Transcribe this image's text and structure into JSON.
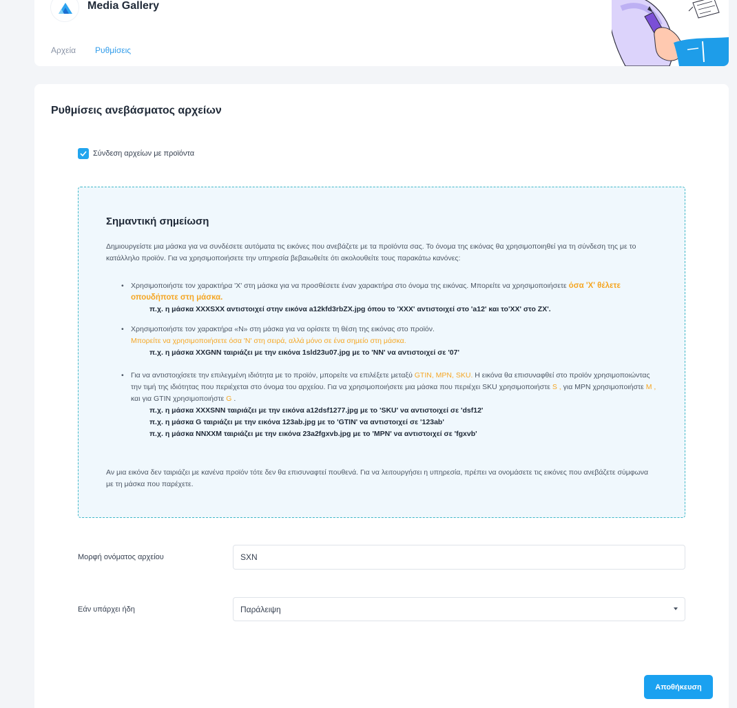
{
  "header": {
    "app_title": "Media Gallery",
    "tabs": [
      {
        "label": "Αρχεία",
        "active": false
      },
      {
        "label": "Ρυθμίσεις",
        "active": true
      }
    ]
  },
  "settings": {
    "section_title": "Ρυθμίσεις ανεβάσματος αρχείων",
    "link_files_checkbox": {
      "label": "Σύνδεση αρχείων με προϊόντα",
      "checked": true
    },
    "note": {
      "title": "Σημαντική σημείωση",
      "intro": "Δημιουργείστε μια μάσκα για να συνδέσετε αυτόματα τις εικόνες που ανεβάζετε με τα προϊόντα σας. Το όνομα της εικόνας θα χρησιμοποιηθεί για τη σύνδεση της με το κατάλληλο προϊόν. Για να χρησιμοποιήσετε την υπηρεσία βεβαιωθείτε ότι ακολουθείτε τους παρακάτω κανόνες:",
      "rules": [
        {
          "text": "Χρησιμοποιήστε τον χαρακτήρα 'X' στη μάσκα για να προσθέσετε έναν χαρακτήρα στο όνομα της εικόνας. Μπορείτε να χρησιμοποιήσετε ",
          "highlight": "όσα 'X' θέλετε οπουδήποτε στη μάσκα.",
          "examples": [
            "π.χ. η μάσκα XXXSXX αντιστοιχεί στην εικόνα a12kfd3rbZX.jpg όπου το 'XXX' αντιστοιχεί στο 'a12' και το'XX' στο ZX'."
          ]
        },
        {
          "text": "Χρησιμοποιήστε τον χαρακτήρα «N» στη μάσκα για να ορίσετε τη θέση της εικόνας στο προϊόν.",
          "highlight": "Μπορείτε να χρησιμοποιήσετε όσα 'N' στη σειρά, αλλά μόνο σε ένα σημείο στη μάσκα.",
          "examples": [
            "π.χ. η μάσκα XXGNN ταιριάζει με την εικόνα 1sld23u07.jpg με το 'NN' να αντιστοιχεί σε '07'"
          ]
        },
        {
          "text_1": "Για να αντιστοιχίσετε την επιλεγμένη ιδιότητα με το προϊόν, μπορείτε να επιλέξετε μεταξύ ",
          "highlight_1": "GTIN, MPN, SKU.",
          "text_2": " Η εικόνα θα επισυναφθεί στο προϊόν χρησιμοποιώντας την τιμή της ιδιότητας που περιέχεται στο όνομα του αρχείου. Για να χρησιμοποιήσετε μια μάσκα που περιέχει SKU χρησιμοποιήστε ",
          "highlight_s": "S ,",
          "text_3": " για MPN χρησιμοποιήστε ",
          "highlight_m": "M ,",
          "text_4": " και για GTIN χρησιμοποιήστε ",
          "highlight_g": "G",
          "text_5": " .",
          "examples": [
            "π.χ. η μάσκα XXXSNN ταιριάζει με την εικόνα a12dsf1277.jpg με το 'SKU' να αντιστοιχεί σε 'dsf12'",
            "π.χ. η μάσκα G ταιριάζει με την εικόνα 123ab.jpg με το 'GTIN' να αντιστοιχεί σε '123ab'",
            "π.χ. η μάσκα NNXXM ταιριάζει με την εικόνα 23a2fgxvb.jpg με το 'MPN' να αντιστοιχεί σε 'fgxvb'"
          ]
        }
      ],
      "outro": "Αν μια εικόνα δεν ταιριάζει με κανένα προϊόν τότε δεν θα επισυναφτεί πουθενά. Για να λειτουργήσει η υπηρεσία, πρέπει να ονομάσετε τις εικόνες που ανεβάζετε σύμφωνα με τη μάσκα που παρέχετε."
    },
    "filename_format": {
      "label": "Μορφή ονόματος αρχείου",
      "value": "SXN"
    },
    "if_exists": {
      "label": "Εάν υπάρχει ήδη",
      "value": "Παράλειψη"
    },
    "save_label": "Αποθήκευση"
  },
  "colors": {
    "accent": "#2f9bea",
    "highlight": "#f5a623",
    "note_border": "#3db7c7",
    "note_background": "#f0f8fd",
    "button": "#1aa1f0"
  },
  "icons": {
    "logo": "triangle-logo-icon",
    "checkbox": "check-icon",
    "select": "caret-down-icon",
    "illustration": "hand-holding-pen-illustration"
  }
}
